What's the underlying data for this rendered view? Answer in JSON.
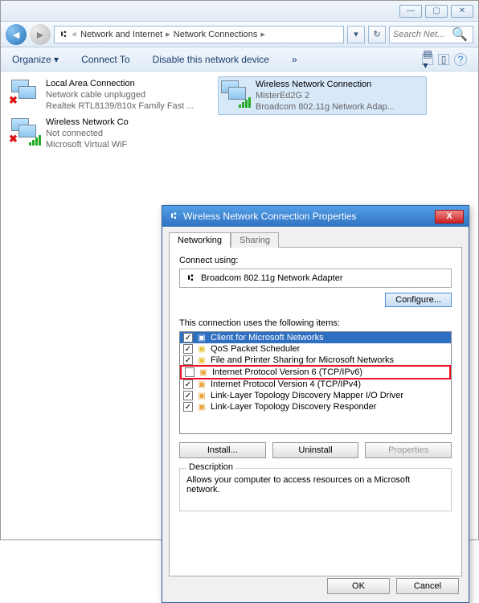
{
  "breadcrumb": {
    "seg1": "Network and Internet",
    "seg2": "Network Connections"
  },
  "search": {
    "placeholder": "Search Net..."
  },
  "toolbar": {
    "organize": "Organize",
    "connect_to": "Connect To",
    "disable": "Disable this network device",
    "chevrons": "»"
  },
  "connections": [
    {
      "title": "Local Area Connection",
      "sub1": "Network cable unplugged",
      "sub2": "Realtek RTL8139/810x Family Fast ...",
      "has_x": true,
      "has_bars": false
    },
    {
      "title": "Wireless Network Connection",
      "sub1": "MisterEd2G  2",
      "sub2": "Broadcom 802.11g Network Adap...",
      "has_x": false,
      "has_bars": true,
      "selected": true
    },
    {
      "title": "Wireless Network Co",
      "sub1": "Not connected",
      "sub2": "Microsoft Virtual WiF",
      "has_x": true,
      "has_bars": true
    }
  ],
  "dialog": {
    "title": "Wireless Network Connection Properties",
    "tabs": {
      "networking": "Networking",
      "sharing": "Sharing"
    },
    "connect_using": "Connect using:",
    "adapter": "Broadcom 802.11g Network Adapter",
    "configure": "Configure...",
    "items_label": "This connection uses the following items:",
    "items": [
      {
        "checked": true,
        "label": "Client for Microsoft Networks",
        "selected": true,
        "icon": "client"
      },
      {
        "checked": true,
        "label": "QoS Packet Scheduler",
        "icon": "qos"
      },
      {
        "checked": true,
        "label": "File and Printer Sharing for Microsoft Networks",
        "icon": "share"
      },
      {
        "checked": false,
        "label": "Internet Protocol Version 6 (TCP/IPv6)",
        "highlight": true,
        "icon": "proto"
      },
      {
        "checked": true,
        "label": "Internet Protocol Version 4 (TCP/IPv4)",
        "icon": "proto"
      },
      {
        "checked": true,
        "label": "Link-Layer Topology Discovery Mapper I/O Driver",
        "icon": "proto"
      },
      {
        "checked": true,
        "label": "Link-Layer Topology Discovery Responder",
        "icon": "proto"
      }
    ],
    "install": "Install...",
    "uninstall": "Uninstall",
    "properties": "Properties",
    "desc_label": "Description",
    "desc_text": "Allows your computer to access resources on a Microsoft network.",
    "ok": "OK",
    "cancel": "Cancel"
  }
}
